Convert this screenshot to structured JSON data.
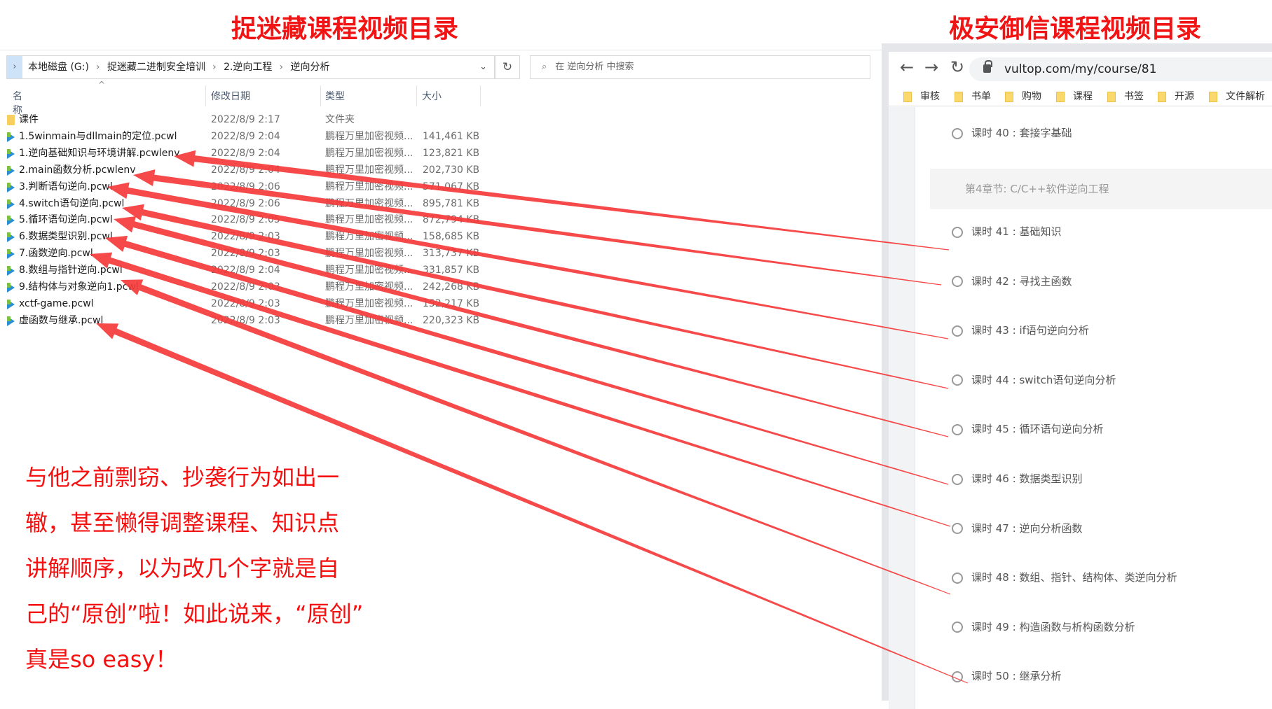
{
  "titles": {
    "left": "捉迷藏课程视频目录",
    "right": "极安御信课程视频目录"
  },
  "explorer": {
    "breadcrumb": [
      "本地磁盘 (G:)",
      "捉迷藏二进制安全培训",
      "2.逆向工程",
      "逆向分析"
    ],
    "search_placeholder": "在 逆向分析 中搜索",
    "columns": [
      "名称",
      "修改日期",
      "类型",
      "大小"
    ],
    "files": [
      {
        "name": "课件",
        "date": "2022/8/9 2:17",
        "type": "文件夹",
        "size": "",
        "kind": "folder"
      },
      {
        "name": "1.5winmain与dllmain的定位.pcwl",
        "date": "2022/8/9 2:04",
        "type": "鹏程万里加密视频...",
        "size": "141,461 KB",
        "kind": "video"
      },
      {
        "name": "1.逆向基础知识与环境讲解.pcwlenv",
        "date": "2022/8/9 2:04",
        "type": "鹏程万里加密视频...",
        "size": "123,821 KB",
        "kind": "video"
      },
      {
        "name": "2.main函数分析.pcwlenv",
        "date": "2022/8/9 2:04",
        "type": "鹏程万里加密视频...",
        "size": "202,730 KB",
        "kind": "video"
      },
      {
        "name": "3.判断语句逆向.pcwl",
        "date": "2022/8/9 2:06",
        "type": "鹏程万里加密视频...",
        "size": "571,067 KB",
        "kind": "video"
      },
      {
        "name": "4.switch语句逆向.pcwl",
        "date": "2022/8/9 2:06",
        "type": "鹏程万里加密视频...",
        "size": "895,781 KB",
        "kind": "video"
      },
      {
        "name": "5.循环语句逆向.pcwl",
        "date": "2022/8/9 2:05",
        "type": "鹏程万里加密视频...",
        "size": "872,794 KB",
        "kind": "video"
      },
      {
        "name": "6.数据类型识别.pcwl",
        "date": "2022/8/9 2:03",
        "type": "鹏程万里加密视频...",
        "size": "158,685 KB",
        "kind": "video"
      },
      {
        "name": "7.函数逆向.pcwl",
        "date": "2022/8/9 2:03",
        "type": "鹏程万里加密视频...",
        "size": "313,737 KB",
        "kind": "video"
      },
      {
        "name": "8.数组与指针逆向.pcwl",
        "date": "2022/8/9 2:04",
        "type": "鹏程万里加密视频...",
        "size": "331,857 KB",
        "kind": "video"
      },
      {
        "name": "9.结构体与对象逆向1.pcwl",
        "date": "2022/8/9 2:03",
        "type": "鹏程万里加密视频...",
        "size": "242,268 KB",
        "kind": "video"
      },
      {
        "name": "xctf-game.pcwl",
        "date": "2022/8/9 2:03",
        "type": "鹏程万里加密视频...",
        "size": "152,217 KB",
        "kind": "video"
      },
      {
        "name": "虚函数与继承.pcwl",
        "date": "2022/8/9 2:03",
        "type": "鹏程万里加密视频...",
        "size": "220,323 KB",
        "kind": "video"
      }
    ]
  },
  "comment": [
    "与他之前剽窃、抄袭行为如出一",
    "辙，甚至懒得调整课程、知识点",
    "讲解顺序，以为改几个字就是自",
    "己的“原创”啦！如此说来，“原创”",
    "真是so easy！"
  ],
  "browser": {
    "url": "vultop.com/my/course/81",
    "bookmarks": [
      "审核",
      "书单",
      "购物",
      "课程",
      "书签",
      "开源",
      "文件解析"
    ],
    "chapter": "第4章节: C/C++软件逆向工程",
    "lessons": [
      "课时 40 : 套接字基础",
      "课时 41 : 基础知识",
      "课时 42 : 寻找主函数",
      "课时 43 : if语句逆向分析",
      "课时 44 : switch语句逆向分析",
      "课时 45 : 循环语句逆向分析",
      "课时 46 : 数据类型识别",
      "课时 47 : 逆向分析函数",
      "课时 48 : 数组、指针、结构体、类逆向分析",
      "课时 49 : 构造函数与析构函数分析",
      "课时 50 : 继承分析"
    ]
  },
  "colors": {
    "annotation_red": "#f50f0f",
    "arrow_red": "#f53a3a"
  }
}
